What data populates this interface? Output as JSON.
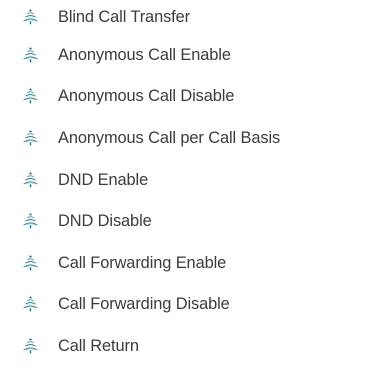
{
  "bullet_icon": "tree-bullet-icon",
  "colors": {
    "text": "#3c3c3c",
    "icon_dark": "#2a6e78",
    "icon_light": "#5cc8d6"
  },
  "items": [
    {
      "label": "Blind Call Transfer"
    },
    {
      "label": "Anonymous Call Enable"
    },
    {
      "label": "Anonymous Call Disable"
    },
    {
      "label": "Anonymous Call per Call Basis"
    },
    {
      "label": "DND Enable"
    },
    {
      "label": "DND Disable"
    },
    {
      "label": "Call Forwarding Enable"
    },
    {
      "label": "Call Forwarding Disable"
    },
    {
      "label": "Call Return"
    }
  ]
}
